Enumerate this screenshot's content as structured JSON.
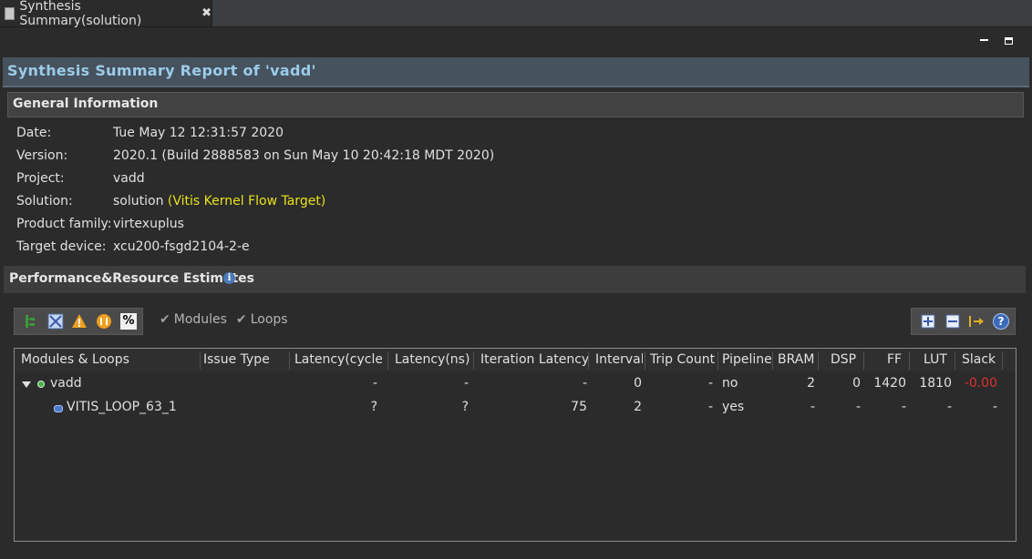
{
  "tab": {
    "label": "Synthesis Summary(solution)",
    "close": "✖"
  },
  "report": {
    "title": "Synthesis Summary Report of 'vadd'"
  },
  "general": {
    "title": "General Information",
    "rows": [
      {
        "label": "Date:",
        "value": "Tue May 12 12:31:57 2020"
      },
      {
        "label": "Version:",
        "value": "2020.1 (Build 2888583 on Sun May 10 20:42:18 MDT 2020)"
      },
      {
        "label": "Project:",
        "value": "vadd"
      },
      {
        "label": "Solution:",
        "value": "solution",
        "note": "(Vitis Kernel Flow Target)"
      },
      {
        "label": "Product family:",
        "value": "virtexuplus"
      },
      {
        "label": "Target device:",
        "value": "xcu200-fsgd2104-2-e"
      }
    ]
  },
  "perf": {
    "title": "Performance&Resource Estimates",
    "info_icon": "i",
    "toolbar_left_icons": [
      "hierarchy-icon",
      "schedule-icon",
      "warning-icon",
      "tips-icon",
      "percent-icon"
    ],
    "percent_label": "%",
    "modules_label": "Modules",
    "loops_label": "Loops",
    "check_mark": "✔",
    "toolbar_right_icons": [
      "expand-all-icon",
      "collapse-all-icon",
      "goto-source-icon",
      "help-icon"
    ],
    "help_label": "?"
  },
  "table": {
    "headers": [
      "Modules & Loops",
      "Issue Type",
      "Latency(cycles)",
      "Latency(ns)",
      "Iteration Latency",
      "Interval",
      "Trip Count",
      "Pipelined",
      "BRAM",
      "DSP",
      "FF",
      "LUT",
      "Slack"
    ],
    "rows": [
      {
        "name": "vadd",
        "issue": "",
        "lat_cycles": "-",
        "lat_ns": "-",
        "iter_lat": "-",
        "interval": "0",
        "trip": "-",
        "pipelined": "no",
        "bram": "2",
        "dsp": "0",
        "ff": "1420",
        "lut": "1810",
        "slack": "-0.00"
      },
      {
        "name": "VITIS_LOOP_63_1",
        "issue": "",
        "lat_cycles": "?",
        "lat_ns": "?",
        "iter_lat": "75",
        "interval": "2",
        "trip": "-",
        "pipelined": "yes",
        "bram": "-",
        "dsp": "-",
        "ff": "-",
        "lut": "-",
        "slack": "-"
      }
    ]
  },
  "colors": {
    "accent_title": "#9ccbe8",
    "note_yellow": "#e8e21c",
    "slack_red": "#e03030"
  }
}
